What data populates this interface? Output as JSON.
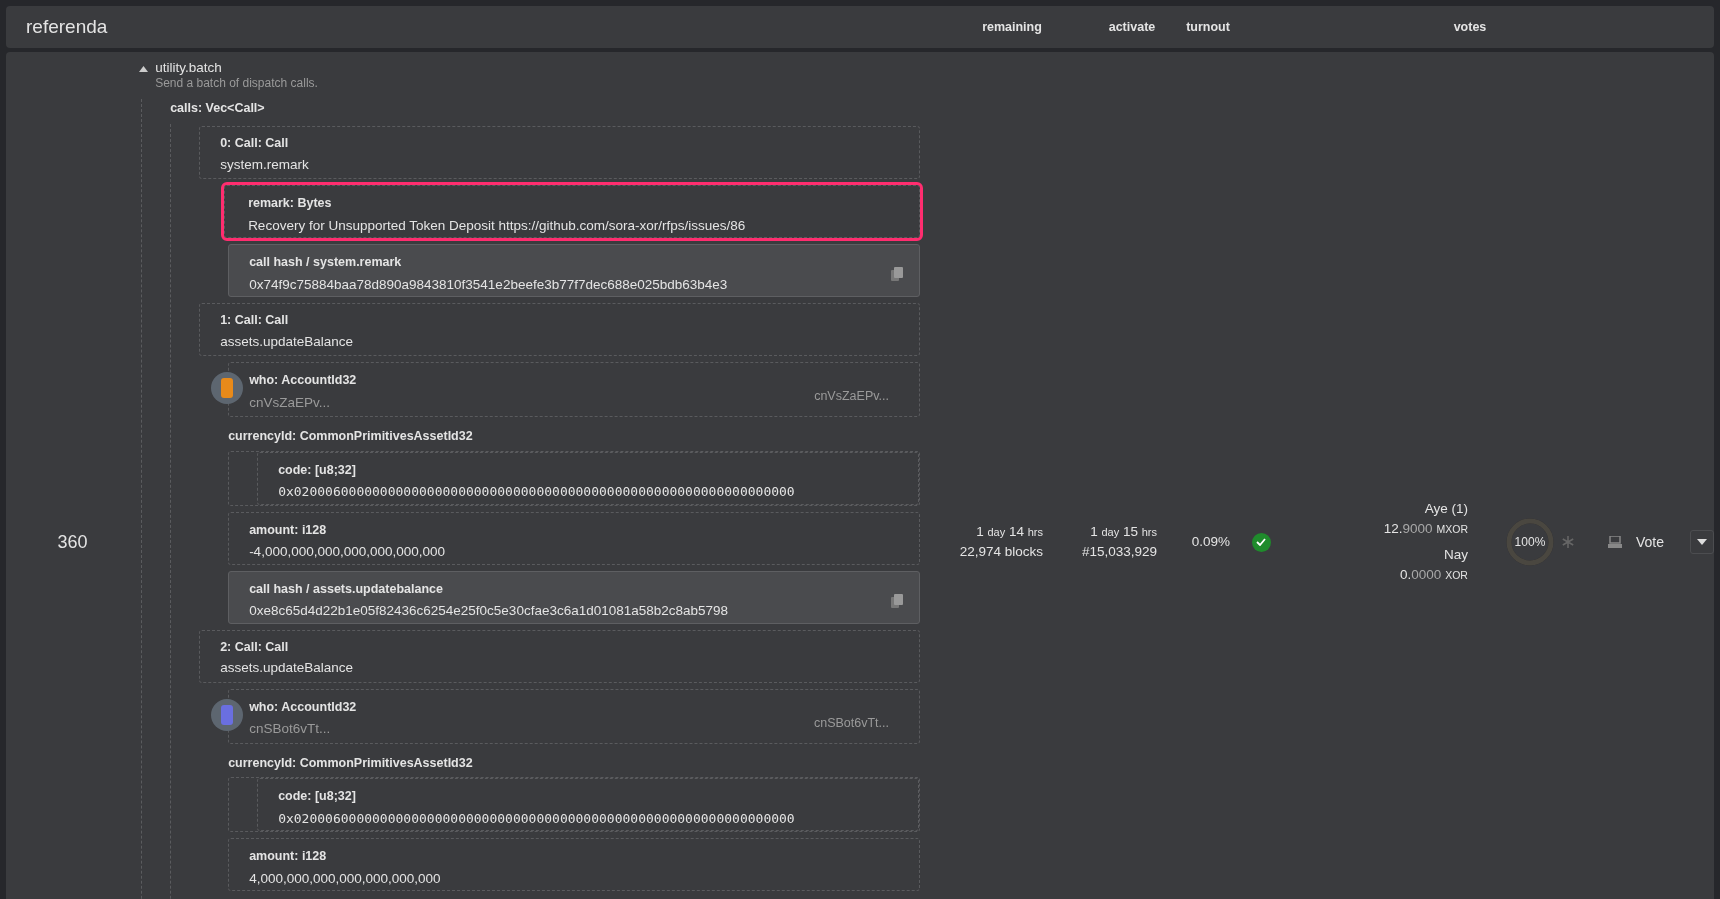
{
  "header": {
    "title": "referenda",
    "columns": [
      "remaining",
      "activate",
      "turnout",
      "votes"
    ]
  },
  "referendum": {
    "index": "360",
    "proposal": {
      "method": "utility.batch",
      "description": "Send a batch of dispatch calls.",
      "expanded": true,
      "param_label": "calls: Vec<Call>",
      "calls": [
        {
          "label": "0: Call: Call",
          "method": "system.remark",
          "params": [
            {
              "kind": "text",
              "label": "remark: Bytes",
              "value": "Recovery for Unsupported Token Deposit https://github.com/sora-xor/rfps/issues/86",
              "highlighted": true
            },
            {
              "kind": "hash",
              "label": "call hash / system.remark",
              "value": "0x74f9c75884baa78d890a9843810f3541e2beefe3b77f7dec688e025bdb63b4e3",
              "highlighted": false
            }
          ]
        },
        {
          "label": "1: Call: Call",
          "method": "assets.updateBalance",
          "params": [
            {
              "kind": "account",
              "label": "who: AccountId32",
              "value": "cnVsZaEPv...",
              "address": "cnVsZaEPv...",
              "color": "#e88a1a",
              "highlighted": false
            },
            {
              "kind": "struct",
              "label": "currencyId: CommonPrimitivesAssetId32",
              "highlighted": false,
              "children": [
                {
                  "kind": "mono",
                  "label": "code: [u8;32]",
                  "value": "0x0200060000000000000000000000000000000000000000000000000000000000",
                  "highlighted": false
                }
              ]
            },
            {
              "kind": "text",
              "label": "amount: i128",
              "value": "-4,000,000,000,000,000,000,000",
              "highlighted": false
            },
            {
              "kind": "hash",
              "label": "call hash / assets.updatebalance",
              "value": "0xe8c65d4d22b1e05f82436c6254e25f0c5e30cfae3c6a1d01081a58b2c8ab5798",
              "highlighted": false
            }
          ]
        },
        {
          "label": "2: Call: Call",
          "method": "assets.updateBalance",
          "params": [
            {
              "kind": "account",
              "label": "who: AccountId32",
              "value": "cnSBot6vTt...",
              "address": "cnSBot6vTt...",
              "color": "#6a6fe0",
              "highlighted": false
            },
            {
              "kind": "struct",
              "label": "currencyId: CommonPrimitivesAssetId32",
              "highlighted": false,
              "children": [
                {
                  "kind": "mono",
                  "label": "code: [u8;32]",
                  "value": "0x0200060000000000000000000000000000000000000000000000000000000000",
                  "highlighted": false
                }
              ]
            },
            {
              "kind": "text",
              "label": "amount: i128",
              "value": "4,000,000,000,000,000,000,000",
              "highlighted": false
            }
          ]
        }
      ]
    },
    "remaining": {
      "time": [
        {
          "value": "1",
          "unit": "day"
        },
        {
          "value": "14",
          "unit": "hrs"
        }
      ],
      "blocks": "22,974 blocks"
    },
    "activate": {
      "time": [
        {
          "value": "1",
          "unit": "day"
        },
        {
          "value": "15",
          "unit": "hrs"
        }
      ],
      "block": "#15,033,929"
    },
    "turnout": {
      "value": "0.09%",
      "passing": true
    },
    "votes": {
      "aye": {
        "label": "Aye (1)",
        "int": "12.",
        "frac": "9000",
        "unit": "MXOR"
      },
      "nay": {
        "label": "Nay",
        "int": "0.",
        "frac": "0000",
        "unit": "XOR"
      },
      "support": "100%",
      "level": 1
    },
    "vote_button": "Vote"
  }
}
